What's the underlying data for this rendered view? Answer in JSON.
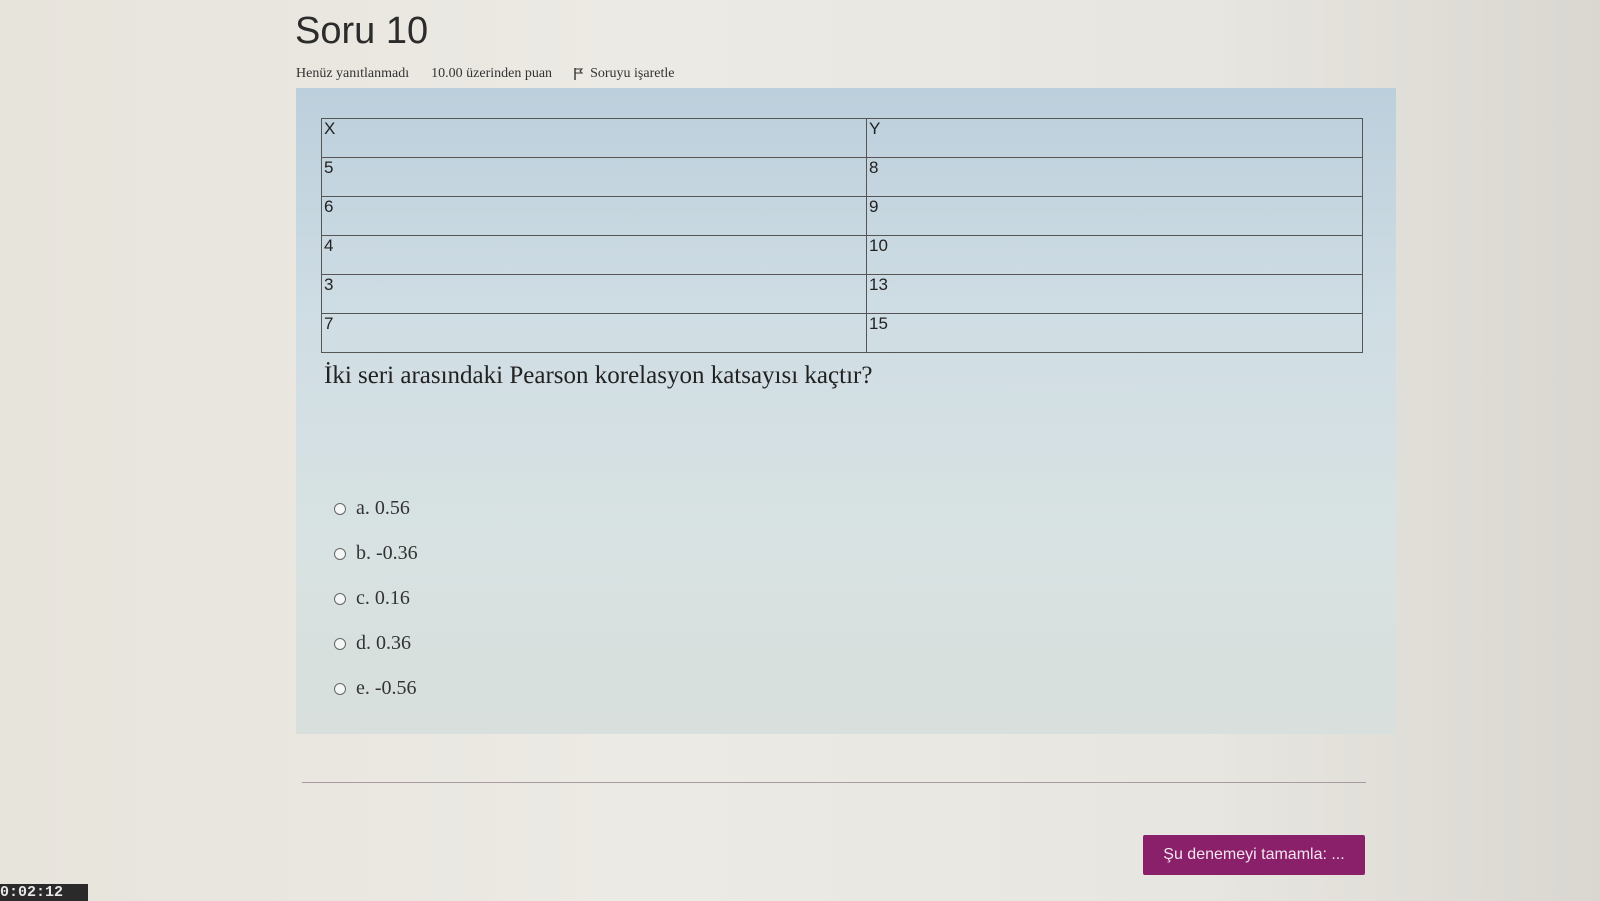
{
  "question": {
    "title": "Soru 10",
    "status": "Henüz yanıtlanmadı",
    "points": "10.00 üzerinden puan",
    "flag_label": "Soruyu işaretle",
    "table": {
      "headers": [
        "X",
        "Y"
      ],
      "rows": [
        [
          "5",
          "8"
        ],
        [
          "6",
          "9"
        ],
        [
          "4",
          "10"
        ],
        [
          "3",
          "13"
        ],
        [
          "7",
          "15"
        ]
      ]
    },
    "text": "İki seri arasındaki Pearson korelasyon katsayısı kaçtır?",
    "options": [
      "a. 0.56",
      "b. -0.36",
      "c. 0.16",
      "d. 0.36",
      "e. -0.56"
    ]
  },
  "footer": {
    "finish_label": "Şu denemeyi tamamla: ..."
  },
  "timer": "0:02:12",
  "colors": {
    "accent": "#8a1f6a",
    "panel": "#cfdde4"
  }
}
